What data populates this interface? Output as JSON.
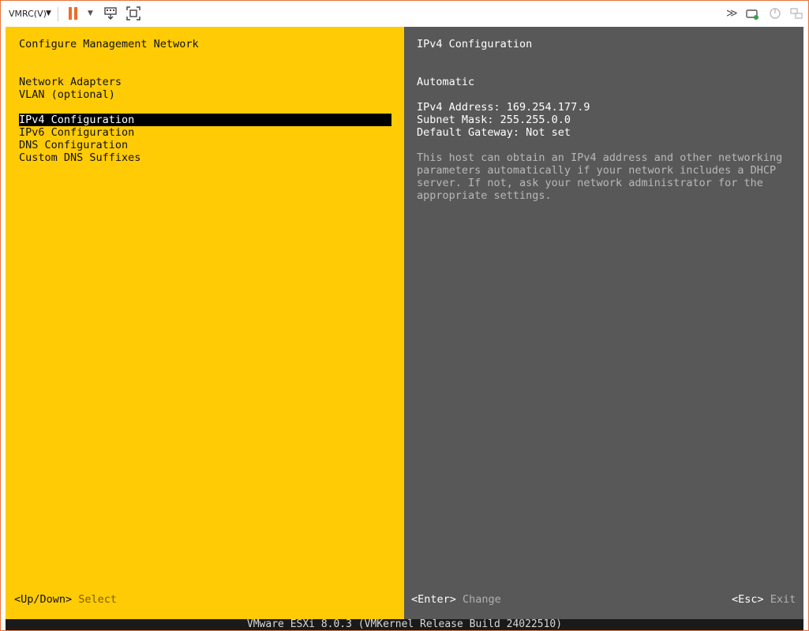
{
  "toolbar": {
    "menu_label": "VMRC(V)",
    "icons": [
      "chevron-down-icon",
      "pause-icon",
      "send-keys-icon",
      "fit-window-icon",
      "fast-forward-icon",
      "removable-device-icon",
      "power-icon",
      "network-icon"
    ]
  },
  "left": {
    "title": "Configure Management Network",
    "items": [
      {
        "label": "Network Adapters"
      },
      {
        "label": "VLAN (optional)"
      },
      {
        "label": "IPv4 Configuration",
        "selected": true
      },
      {
        "label": "IPv6 Configuration"
      },
      {
        "label": "DNS Configuration"
      },
      {
        "label": "Custom DNS Suffixes"
      }
    ],
    "footer": {
      "key": "<Up/Down>",
      "action": "Select"
    }
  },
  "right": {
    "title": "IPv4 Configuration",
    "mode": "Automatic",
    "ipv4_address": "IPv4 Address: 169.254.177.9",
    "subnet_mask": "Subnet Mask: 255.255.0.0",
    "default_gateway": "Default Gateway: Not set",
    "description": [
      "This host can obtain an IPv4 address and other networking",
      "parameters automatically if your network includes a DHCP",
      "server. If not, ask your network administrator for the",
      "appropriate settings."
    ],
    "footer_left": {
      "key": "<Enter>",
      "action": "Change"
    },
    "footer_right": {
      "key": "<Esc>",
      "action": "Exit"
    }
  },
  "status_bar": "VMware ESXi 8.0.3 (VMKernel Release Build 24022510)",
  "colors": {
    "left_bg": "#ffcb05",
    "right_bg": "#585858",
    "accent": "#ef6c2a",
    "status_bg": "#1a1a1a"
  }
}
